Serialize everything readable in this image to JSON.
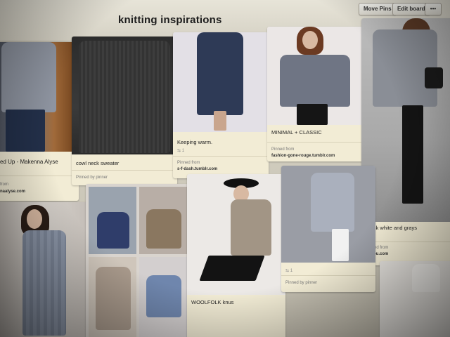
{
  "board": {
    "title": "knitting inspirations",
    "buttons": {
      "move_pins": "Move Pins",
      "edit_board": "Edit board",
      "more": "•••"
    }
  },
  "pins": [
    {
      "caption": "ed Up - Makenna Alyse",
      "source_label": "from",
      "source": "naalyse.com"
    },
    {
      "caption": "cowl neck sweater",
      "pinned_by": "Pinned by pinner"
    },
    {
      "caption": "Keeping warm.",
      "meta": "⇆ 1",
      "source_label": "Pinned from",
      "source": "s-f-dash.tumblr.com"
    },
    {
      "caption": "MINIMAL + CLASSIC",
      "source_label": "Pinned from",
      "source": "fashion-gone-rouge.tumblr.com"
    },
    {
      "caption": "Black white and grays",
      "meta": "⇆ 1",
      "source_label": "Pinned from",
      "source": "tolnbu.com"
    },
    {
      "caption": "",
      "meta": "⇆ 1",
      "pinned_by": "Pinned by pinner"
    },
    {
      "caption": "WOOLFOLK knus"
    }
  ],
  "colors": {
    "card": "#f2ecd5",
    "header": "#e2dfd3",
    "title": "#1c1c1c"
  }
}
